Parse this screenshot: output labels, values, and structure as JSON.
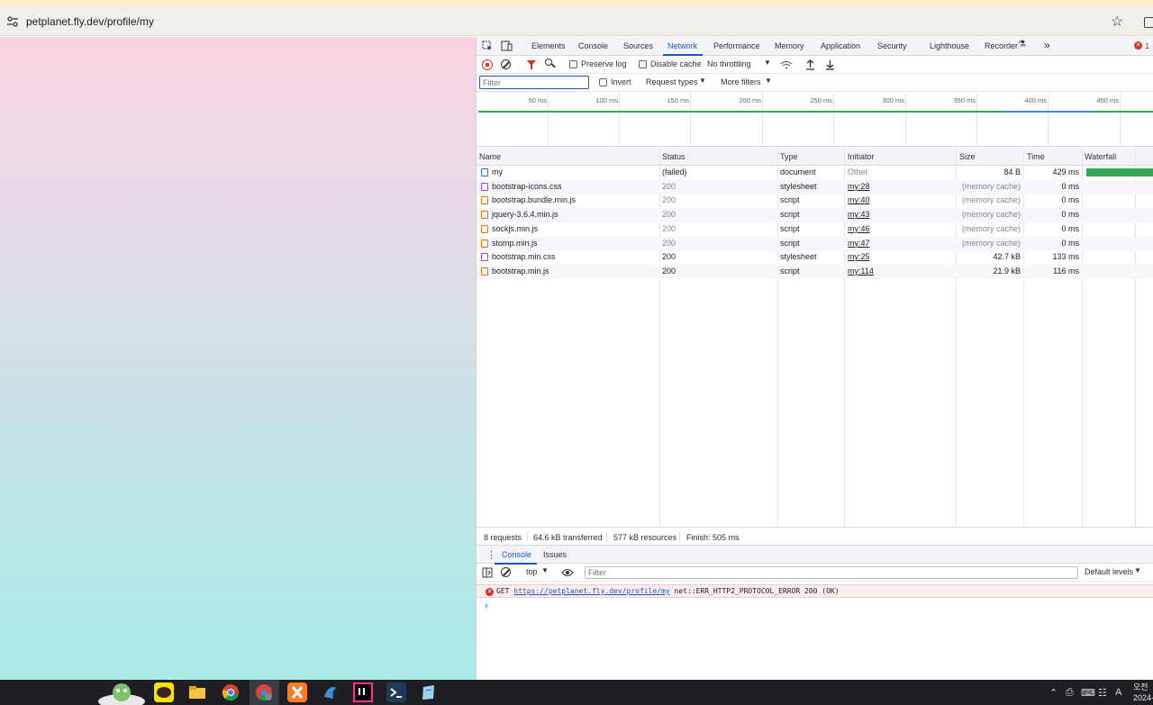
{
  "browser": {
    "url": "petplanet.fly.dev/profile/my"
  },
  "devtools": {
    "tabs": [
      "Elements",
      "Console",
      "Sources",
      "Network",
      "Performance",
      "Memory",
      "Application",
      "Security",
      "Lighthouse",
      "Recorder"
    ],
    "active_tab": "Network",
    "error_count": "1",
    "toolbar": {
      "preserve_log": "Preserve log",
      "disable_cache": "Disable cache",
      "throttling": "No throttling"
    },
    "filter": {
      "placeholder": "Filter",
      "invert": "Invert",
      "request_types": "Request types",
      "more_filters": "More filters"
    },
    "timeline_labels": [
      "50 ms",
      "100 ms",
      "150 ms",
      "200 ms",
      "250 ms",
      "300 ms",
      "350 ms",
      "400 ms",
      "450 ms"
    ],
    "columns": [
      "Name",
      "Status",
      "Type",
      "Initiator",
      "Size",
      "Time",
      "Waterfall"
    ],
    "rows": [
      {
        "name": "my",
        "status": "(failed)",
        "type": "document",
        "initiator": "Other",
        "size": "84 B",
        "time": "429 ms",
        "icon": "document-icon"
      },
      {
        "name": "bootstrap-icons.css",
        "status": "200",
        "type": "stylesheet",
        "initiator": "my:28",
        "size": "(memory cache)",
        "time": "0 ms",
        "icon": "stylesheet-icon"
      },
      {
        "name": "bootstrap.bundle.min.js",
        "status": "200",
        "type": "script",
        "initiator": "my:40",
        "size": "(memory cache)",
        "time": "0 ms",
        "icon": "script-icon"
      },
      {
        "name": "jquery-3.6.4.min.js",
        "status": "200",
        "type": "script",
        "initiator": "my:43",
        "size": "(memory cache)",
        "time": "0 ms",
        "icon": "script-icon"
      },
      {
        "name": "sockjs.min.js",
        "status": "200",
        "type": "script",
        "initiator": "my:46",
        "size": "(memory cache)",
        "time": "0 ms",
        "icon": "script-icon"
      },
      {
        "name": "stomp.min.js",
        "status": "200",
        "type": "script",
        "initiator": "my:47",
        "size": "(memory cache)",
        "time": "0 ms",
        "icon": "script-icon"
      },
      {
        "name": "bootstrap.min.css",
        "status": "200",
        "type": "stylesheet",
        "initiator": "my:25",
        "size": "42.7 kB",
        "time": "133 ms",
        "icon": "stylesheet-icon"
      },
      {
        "name": "bootstrap.min.js",
        "status": "200",
        "type": "script",
        "initiator": "my:114",
        "size": "21.9 kB",
        "time": "116 ms",
        "icon": "script-icon"
      }
    ],
    "summary": {
      "requests": "8 requests",
      "transferred": "64.6 kB transferred",
      "resources": "577 kB resources",
      "finish": "Finish: 505 ms"
    },
    "drawer": {
      "tabs": [
        "Console",
        "Issues"
      ],
      "context": "top",
      "filter_placeholder": "Filter",
      "levels": "Default levels",
      "error": {
        "method": "GET",
        "url": "https://petplanet.fly.dev/profile/my",
        "message": "net::ERR_HTTP2_PROTOCOL_ERROR 200 (OK)"
      },
      "prompt": "›"
    }
  },
  "taskbar": {
    "time_line1": "오전",
    "time_line2": "2024-",
    "tray_lang": "A"
  }
}
